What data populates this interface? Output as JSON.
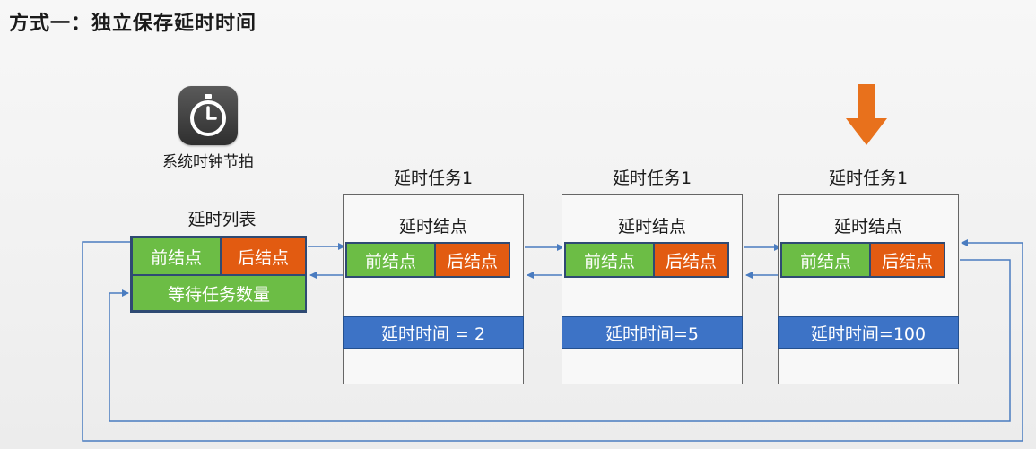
{
  "title": "方式一：独立保存延时时间",
  "clock": {
    "icon": "stopwatch-icon",
    "label": "系统时钟节拍"
  },
  "delay_list": {
    "title": "延时列表",
    "prev": "前结点",
    "next": "后结点",
    "count": "等待任务数量"
  },
  "tasks": [
    {
      "title": "延时任务1",
      "node": "延时结点",
      "prev": "前结点",
      "next": "后结点",
      "delay": "延时时间 = 2"
    },
    {
      "title": "延时任务1",
      "node": "延时结点",
      "prev": "前结点",
      "next": "后结点",
      "delay": "延时时间=5"
    },
    {
      "title": "延时任务1",
      "node": "延时结点",
      "prev": "前结点",
      "next": "后结点",
      "delay": "延时时间=100"
    }
  ],
  "colors": {
    "green": "#6cbd45",
    "orange": "#e25b11",
    "blue": "#3d73c6",
    "border": "#2f4a73",
    "arrow": "#4a7cc0",
    "indicator": "#e8711c"
  }
}
